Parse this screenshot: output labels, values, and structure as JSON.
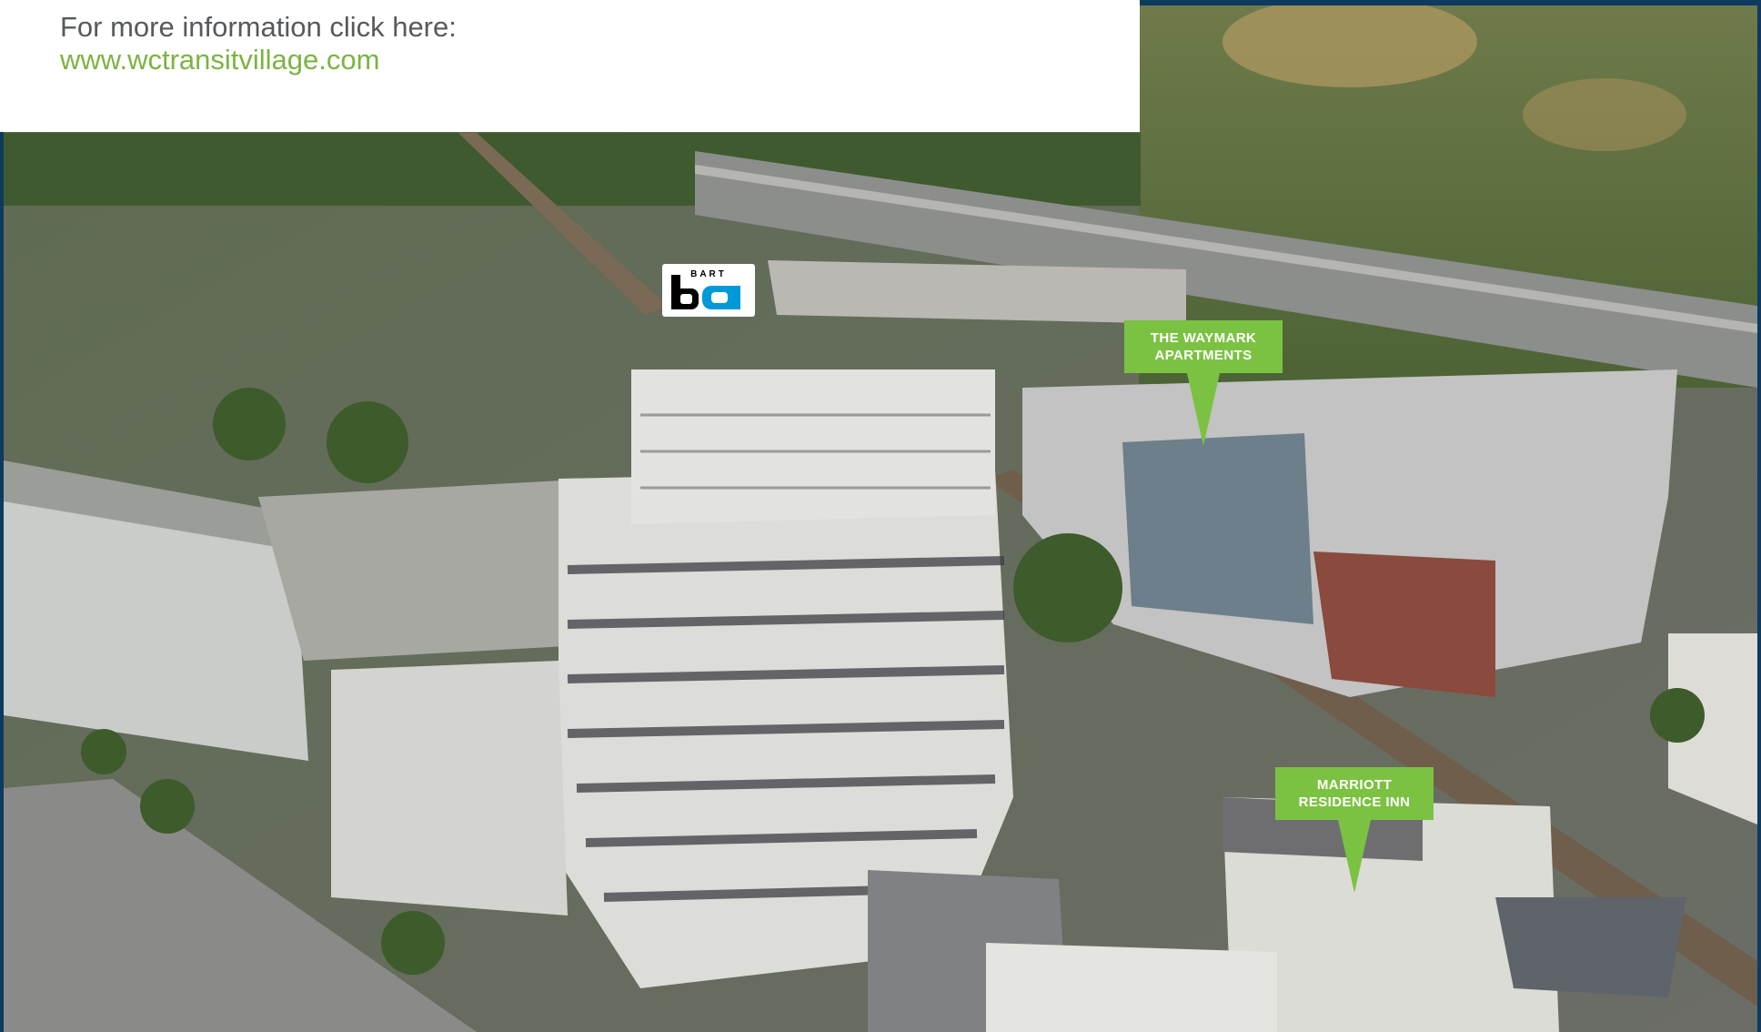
{
  "info": {
    "line1": "For more information click here:",
    "link": "www.wctransitvillage.com"
  },
  "logo": {
    "name": "bart-logo",
    "text": "BART"
  },
  "callouts": {
    "waymark": {
      "line1": "THE WAYMARK",
      "line2": "APARTMENTS"
    },
    "marriott": {
      "line1": "MARRIOTT",
      "line2": "RESIDENCE INN"
    }
  },
  "colors": {
    "frame": "#0e3a5f",
    "accent_green": "#7cc242",
    "link_green": "#7cb342",
    "text_gray": "#555a5e",
    "bart_blue": "#0099d8"
  }
}
